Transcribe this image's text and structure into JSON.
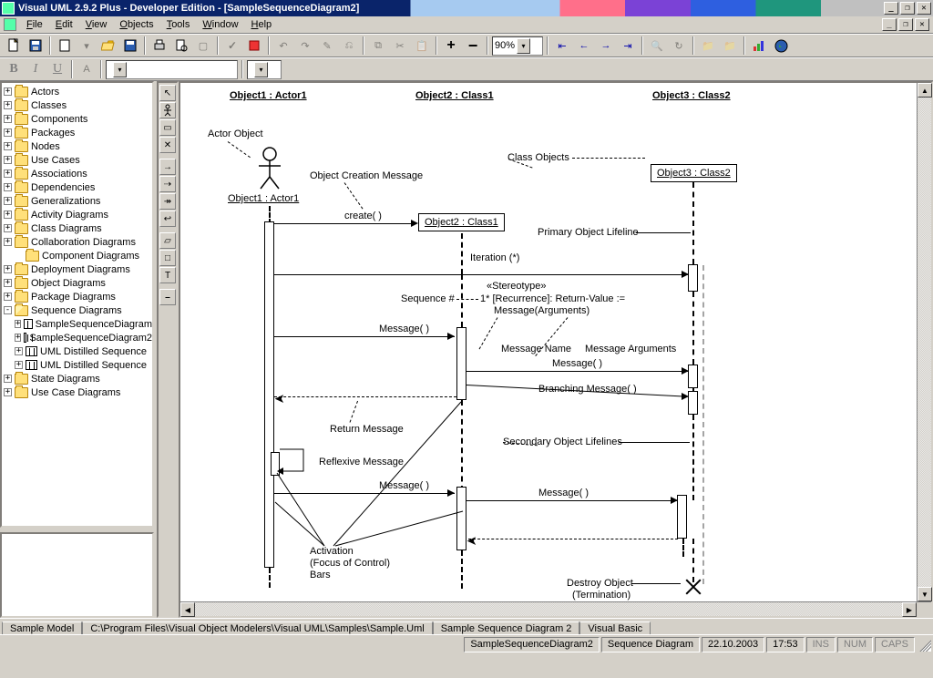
{
  "title": "Visual UML 2.9.2 Plus - Developer Edition - [SampleSequenceDiagram2]",
  "menus": {
    "file": "File",
    "edit": "Edit",
    "view": "View",
    "objects": "Objects",
    "tools": "Tools",
    "window": "Window",
    "help": "Help"
  },
  "zoom": "90%",
  "tree": {
    "roots": [
      "Actors",
      "Classes",
      "Components",
      "Packages",
      "Nodes",
      "Use Cases",
      "Associations",
      "Dependencies",
      "Generalizations",
      "Activity Diagrams",
      "Class Diagrams",
      "Collaboration Diagrams",
      "Component Diagrams",
      "Deployment Diagrams",
      "Object Diagrams",
      "Package Diagrams"
    ],
    "seq_folder": "Sequence Diagrams",
    "seq_items": [
      "SampleSequenceDiagram",
      "SampleSequenceDiagram2",
      "UML Distilled Sequence",
      "UML Distilled Sequence"
    ],
    "after": [
      "State Diagrams",
      "Use Case Diagrams"
    ]
  },
  "diagram": {
    "objects": {
      "o1": "Object1 : Actor1",
      "o2": "Object2 : Class1",
      "o3": "Object3 : Class2"
    },
    "actor_label": "Actor Object",
    "class_objects": "Class Objects",
    "object_creation": "Object Creation Message",
    "create": "create( )",
    "primary_lifeline": "Primary Object Lifeline",
    "iteration": "Iteration (*)",
    "stereotype": "«Stereotype»",
    "sequence": "Sequence #",
    "recurrence": "1* [Recurrence]: Return-Value :=",
    "msg_args_line": "Message(Arguments)",
    "message": "Message( )",
    "message_name": "Message Name",
    "message_arguments": "Message Arguments",
    "branching_msg": "Branching Message( )",
    "return_msg": "Return Message",
    "reflexive": "Reflexive Message",
    "secondary_lifelines": "Secondary Object Lifelines",
    "activation_l1": "Activation",
    "activation_l2": "(Focus of Control)",
    "activation_l3": "Bars",
    "destroy_l1": "Destroy Object",
    "destroy_l2": "(Termination)"
  },
  "tabs": {
    "t1": "Sample Model",
    "t2": "C:\\Program Files\\Visual Object Modelers\\Visual UML\\Samples\\Sample.Uml",
    "t3": "Sample Sequence Diagram 2",
    "t4": "Visual Basic"
  },
  "status": {
    "doc": "SampleSequenceDiagram2",
    "kind": "Sequence Diagram",
    "date": "22.10.2003",
    "time": "17:53",
    "ins": "INS",
    "num": "NUM",
    "caps": "CAPS"
  }
}
